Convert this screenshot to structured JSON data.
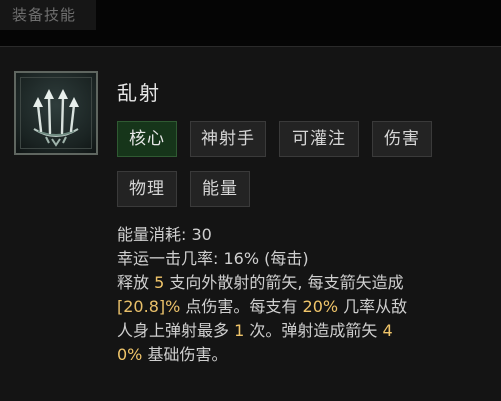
{
  "window": {
    "tab_label": "装备技能"
  },
  "skill": {
    "name": "乱射",
    "icon": "multishot-arrows-icon",
    "tags": [
      {
        "label": "核心",
        "active": true
      },
      {
        "label": "神射手",
        "active": false
      },
      {
        "label": "可灌注",
        "active": false
      },
      {
        "label": "伤害",
        "active": false
      },
      {
        "label": "物理",
        "active": false
      },
      {
        "label": "能量",
        "active": false
      }
    ],
    "stats": {
      "cost_label": "能量消耗:",
      "cost_value": "30",
      "crit_label": "幸运一击几率:",
      "crit_value": "16%",
      "crit_suffix": "(每击)"
    },
    "description": {
      "l1_a": "释放",
      "l1_v1": "5",
      "l1_b": "支向外散射的箭矢, 每支箭矢造成",
      "l2_v1": "[20.8]%",
      "l2_a": "点伤害。每支有",
      "l2_v2": "20%",
      "l2_b": "几率从敌",
      "l3_a": "人身上弹射最多",
      "l3_v1": "1",
      "l3_b": "次。弹射造成箭矢",
      "l3_v2": "4",
      "l4_v1": "0%",
      "l4_a": "基础伤害。"
    }
  },
  "colors": {
    "highlight": "#f0c56a",
    "active_tag_bg": "#16351a",
    "panel_bg": "#141414"
  }
}
